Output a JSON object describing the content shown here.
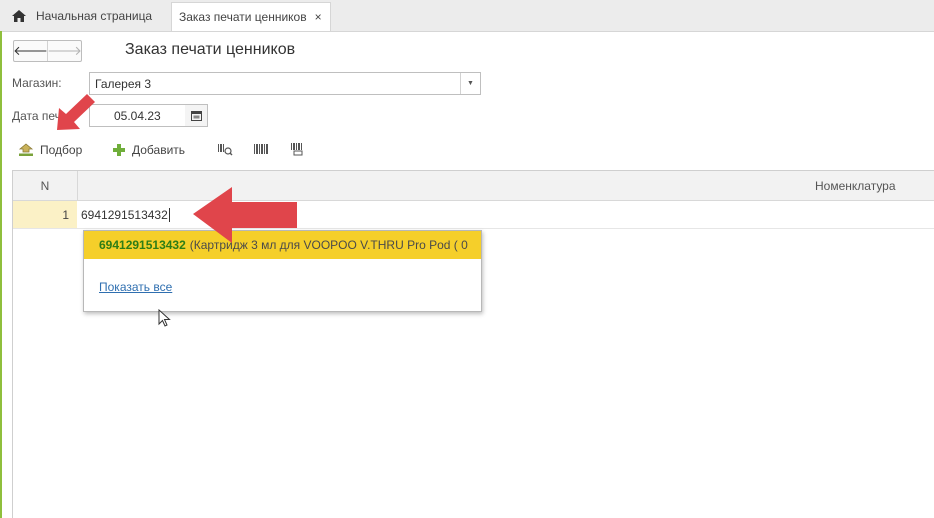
{
  "tabs": [
    {
      "label": "Начальная страница",
      "icon": "home-icon"
    },
    {
      "label": "Заказ печати ценников",
      "close": "×"
    }
  ],
  "nav": {
    "back": "🡐",
    "forward": "🡒"
  },
  "page_title": "Заказ печати ценников",
  "form": {
    "store_label": "Магазин:",
    "store_value": "Галерея 3",
    "date_label": "Дата печ",
    "date_value": "05.04.23"
  },
  "toolbar": {
    "select_label": "Подбор",
    "add_label": "Добавить",
    "icons": [
      "barcode-search-icon",
      "barcode-icon",
      "barcode-print-icon"
    ]
  },
  "table": {
    "columns": [
      "N",
      "Номенклатура"
    ],
    "rows": [
      {
        "n": "1",
        "input": "6941291513432"
      }
    ]
  },
  "autocomplete": {
    "code": "6941291513432",
    "description": "(Картридж 3 мл для VOOPOO V.THRU Pro Pod ( 0",
    "show_all": "Показать все"
  },
  "colors": {
    "accent_green": "#8fbf3c",
    "highlight_yellow": "#f5cf2a",
    "annotation_red": "#e0454b"
  }
}
